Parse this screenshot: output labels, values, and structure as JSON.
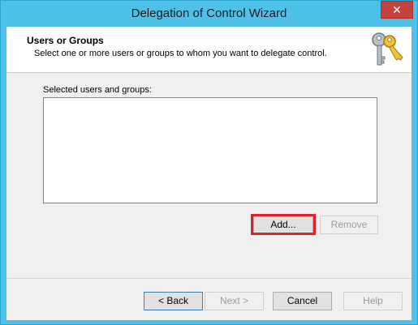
{
  "window": {
    "title": "Delegation of Control Wizard",
    "close_label": "✕"
  },
  "header": {
    "title": "Users or Groups",
    "subtitle": "Select one or more users or groups to whom you want to delegate control."
  },
  "list": {
    "label": "Selected users and groups:",
    "items": []
  },
  "buttons": {
    "add": "Add...",
    "remove": "Remove",
    "back": "< Back",
    "next": "Next >",
    "cancel": "Cancel",
    "help": "Help"
  },
  "colors": {
    "title_bar": "#4fc0e8",
    "close_button": "#c7423a",
    "highlight": "#e0202a"
  },
  "icons": {
    "header": "keys-icon"
  }
}
